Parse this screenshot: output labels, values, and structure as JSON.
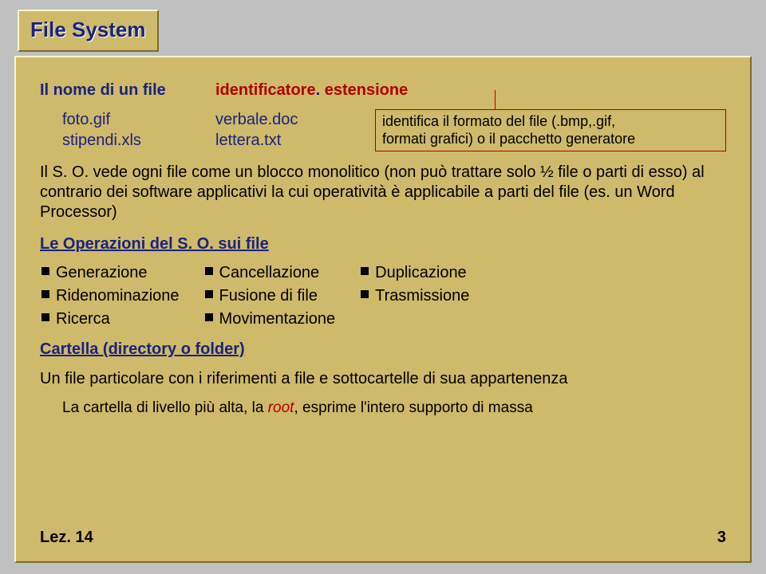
{
  "title": "File System",
  "line1": {
    "label": "Il nome di un file",
    "id": "identificatore",
    "dot": ". ",
    "ext": "estensione"
  },
  "examples": {
    "c1a": "foto.gif",
    "c1b": "stipendi.xls",
    "c2a": "verbale.doc",
    "c2b": "lettera.txt"
  },
  "callout": {
    "l1": "identifica il formato del file (.bmp,.gif,",
    "l2": "formati grafici) o il pacchetto generatore"
  },
  "para": "Il S. O. vede ogni file come un blocco monolitico (non può trattare  solo ½ file o parti di esso) al contrario dei software applicativi la cui operatività è applicabile a parti del file (es. un Word Processor)",
  "heading1": "Le Operazioni del S. O. sui file",
  "bullets": {
    "c1": [
      "Generazione",
      "Ridenominazione",
      "Ricerca"
    ],
    "c2": [
      "Cancellazione",
      "Fusione di file",
      "Movimentazione"
    ],
    "c3": [
      "Duplicazione",
      "Trasmissione"
    ]
  },
  "heading2": "Cartella (directory o folder)",
  "footer1": "Un file particolare con i riferimenti  a file e sottocartelle di sua appartenenza",
  "footer2a": "La cartella di livello più alta, la ",
  "footer2root": "root",
  "footer2b": ", esprime l'intero supporto di massa",
  "lez": "Lez. 14",
  "pagenum": "3"
}
